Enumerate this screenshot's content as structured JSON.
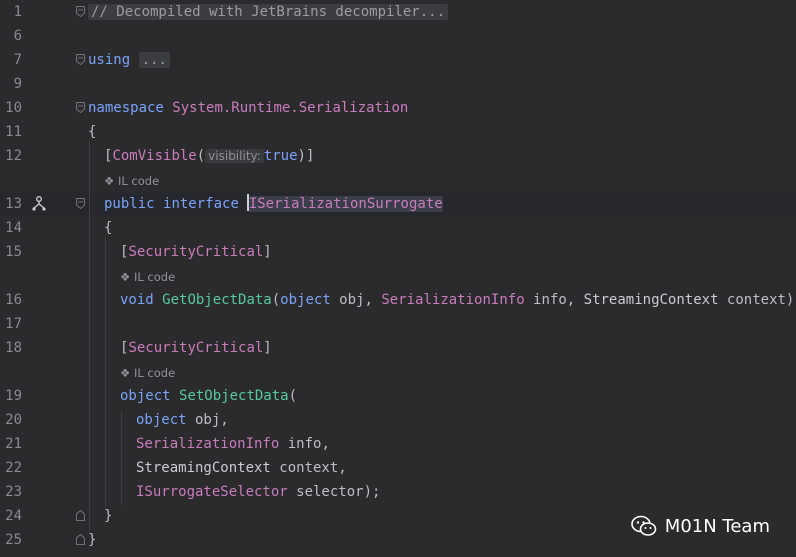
{
  "editor": {
    "line_numbers": [
      "1",
      "6",
      "7",
      "9",
      "10",
      "11",
      "12",
      "",
      "13",
      "14",
      "15",
      "",
      "16",
      "17",
      "18",
      "",
      "19",
      "20",
      "21",
      "22",
      "23",
      "24",
      "25"
    ],
    "lines": {
      "l1": "// Decompiled with JetBrains decompiler...",
      "l7_kw": "using",
      "l7_fold": "...",
      "l10_kw": "namespace",
      "l10_ns": "System.Runtime.Serialization",
      "l11": "{",
      "l12_open": "[",
      "l12_attr": "ComVisible",
      "l12_paren": "(",
      "l12_hint": "visibility:",
      "l12_val": "true",
      "l12_close": ")]",
      "l13_public": "public",
      "l13_interface": "interface",
      "l13_name": "ISerializationSurrogate",
      "l14": "{",
      "l15_open": "[",
      "l15_attr": "SecurityCritical",
      "l15_close": "]",
      "l16_void": "void",
      "l16_method": "GetObjectData",
      "l16_p1type": "object",
      "l16_p1": " obj, ",
      "l16_p2type": "SerializationInfo",
      "l16_p2": " info, ",
      "l16_p3type": "StreamingContext",
      "l16_p3": " context);",
      "l18_open": "[",
      "l18_attr": "SecurityCritical",
      "l18_close": "]",
      "l19_type": "object",
      "l19_method": "SetObjectData",
      "l19_paren": "(",
      "l20_type": "object",
      "l20_rest": " obj,",
      "l21_type": "SerializationInfo",
      "l21_rest": " info,",
      "l22_type": "StreamingContext",
      "l22_rest": " context,",
      "l23_type": "ISurrogateSelector",
      "l23_rest": " selector);",
      "l24": "}",
      "l25": "}"
    },
    "il_code_label": "IL code"
  },
  "watermark": {
    "text": "M01N Team"
  },
  "colors": {
    "background": "#2b2b2d",
    "keyword": "#cf8e6d",
    "type": "#c77dbb",
    "method": "#56a8f5"
  },
  "icons": {
    "implementations": "implementations-icon",
    "fold": "fold-icon",
    "il": "il-code-icon",
    "wechat": "wechat-icon"
  }
}
